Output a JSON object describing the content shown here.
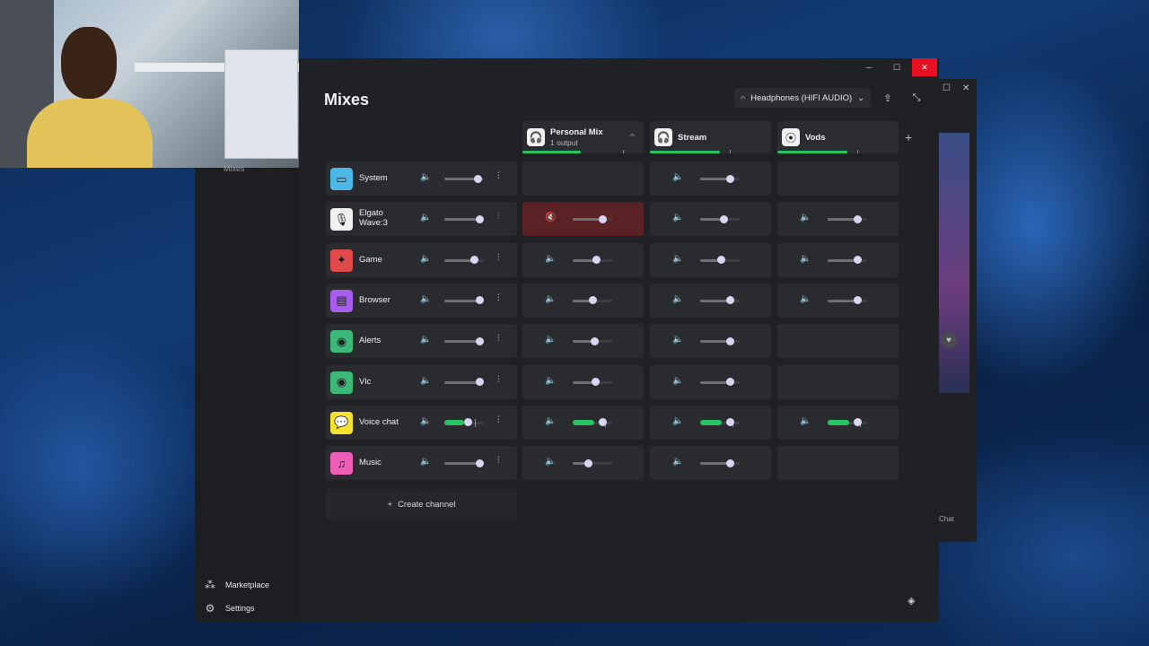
{
  "app": {
    "page_title": "Mixes",
    "device": "Headphones (HIFI AUDIO)",
    "create_channel": "Create channel",
    "sidebar_label": "Mixes",
    "marketplace": "Marketplace",
    "settings": "Settings",
    "back_window_chat": "Chat"
  },
  "mixes": [
    {
      "name": "Personal Mix",
      "sub": "1 output",
      "icon": "headphones-icon",
      "meter": 0.48,
      "marker": 0.83
    },
    {
      "name": "Stream",
      "sub": "",
      "icon": "headphones-icon",
      "meter": 0.58,
      "marker": 0.66
    },
    {
      "name": "Vods",
      "sub": "",
      "icon": "broadcast-icon",
      "meter": 0.58,
      "marker": 0.66
    }
  ],
  "channels": [
    {
      "name": "System",
      "icon": "monitor-icon",
      "color": "#4cb8e8",
      "main": 0.85,
      "mixes": [
        null,
        0.75,
        null
      ]
    },
    {
      "name": "Elgato Wave:3",
      "icon": "microphone-icon",
      "color": "#f0f0f0",
      "main": 0.9,
      "wave_active": true,
      "mixes": [
        0.75,
        0.6,
        0.75
      ],
      "muted": [
        true,
        false,
        false
      ]
    },
    {
      "name": "Game",
      "icon": "game-icon",
      "color": "#e04a4a",
      "main": 0.75,
      "mixes": [
        0.6,
        0.53,
        0.75
      ]
    },
    {
      "name": "Browser",
      "icon": "browser-icon",
      "color": "#a85cf0",
      "main": 0.9,
      "mixes": [
        0.5,
        0.75,
        0.75
      ]
    },
    {
      "name": "Alerts",
      "icon": "alerts-icon",
      "color": "#3cb878",
      "main": 0.9,
      "mixes": [
        0.55,
        0.75,
        null
      ]
    },
    {
      "name": "Vlc",
      "icon": "vlc-icon",
      "color": "#3cb878",
      "main": 0.9,
      "mixes": [
        0.58,
        0.75,
        null
      ]
    },
    {
      "name": "Voice chat",
      "icon": "chat-icon",
      "color": "#f5e22e",
      "main": 0.6,
      "voice": [
        0.5,
        0.55,
        0.55,
        0.55
      ],
      "mixes": [
        0.75,
        0.75,
        0.75
      ]
    },
    {
      "name": "Music",
      "icon": "music-icon",
      "color": "#ee5fb8",
      "main": 0.9,
      "mixes": [
        0.4,
        0.75,
        null
      ]
    }
  ]
}
